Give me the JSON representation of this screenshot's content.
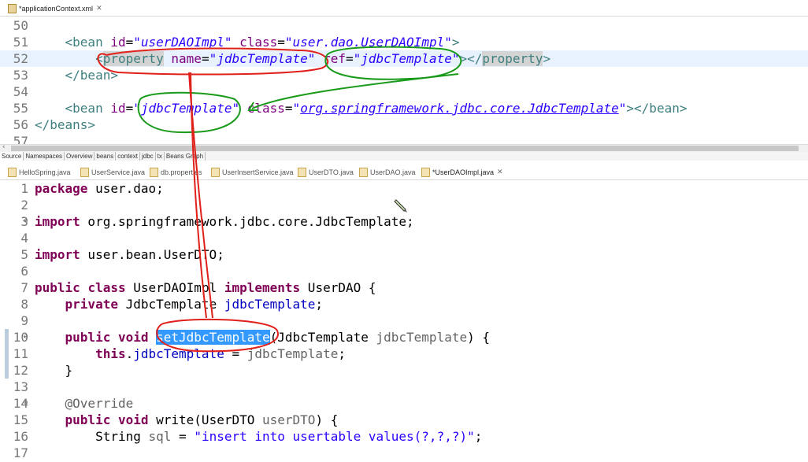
{
  "xml_editor": {
    "tab_label": "*applicationContext.xml",
    "lines": [
      {
        "n": "50",
        "parts": []
      },
      {
        "n": "51",
        "parts": [
          {
            "t": "    ",
            "c": "plain"
          },
          {
            "t": "<bean",
            "c": "tag"
          },
          {
            "t": " id",
            "c": "attr"
          },
          {
            "t": "=",
            "c": "plain"
          },
          {
            "t": "\"userDAOImpl\"",
            "c": "val"
          },
          {
            "t": " class",
            "c": "attr"
          },
          {
            "t": "=",
            "c": "plain"
          },
          {
            "t": "\"user.dao.UserDAOImpl\"",
            "c": "val"
          },
          {
            "t": ">",
            "c": "tag"
          }
        ]
      },
      {
        "n": "52",
        "highlight": true,
        "parts": [
          {
            "t": "        ",
            "c": "plain"
          },
          {
            "t": "<",
            "c": "tag"
          },
          {
            "t": "property",
            "c": "tag occ"
          },
          {
            "t": " name",
            "c": "attr"
          },
          {
            "t": "=",
            "c": "plain"
          },
          {
            "t": "\"jdbcTemplate\"",
            "c": "val"
          },
          {
            "t": " ref",
            "c": "attr"
          },
          {
            "t": "=",
            "c": "plain"
          },
          {
            "t": "\"jdbcTemplate\"",
            "c": "val"
          },
          {
            "t": "></",
            "c": "tag"
          },
          {
            "t": "property",
            "c": "tag occ"
          },
          {
            "t": ">",
            "c": "tag"
          }
        ]
      },
      {
        "n": "53",
        "parts": [
          {
            "t": "    ",
            "c": "plain"
          },
          {
            "t": "</bean>",
            "c": "tag"
          }
        ]
      },
      {
        "n": "54",
        "parts": []
      },
      {
        "n": "55",
        "parts": [
          {
            "t": "    ",
            "c": "plain"
          },
          {
            "t": "<bean",
            "c": "tag"
          },
          {
            "t": " id",
            "c": "attr"
          },
          {
            "t": "=",
            "c": "plain"
          },
          {
            "t": "\"jdbcTemplate\"",
            "c": "val"
          },
          {
            "t": " class",
            "c": "attr"
          },
          {
            "t": "=",
            "c": "plain"
          },
          {
            "t": "\"",
            "c": "val"
          },
          {
            "t": "org.springframework.jdbc.core.JdbcTemplate",
            "c": "val"
          },
          {
            "t": "\"",
            "c": "val"
          },
          {
            "t": "></bean>",
            "c": "tag"
          }
        ]
      },
      {
        "n": "56",
        "parts": [
          {
            "t": "</beans>",
            "c": "tag"
          }
        ]
      },
      {
        "n": "57",
        "parts": []
      }
    ],
    "bottom_tabs": [
      "Source",
      "Namespaces",
      "Overview",
      "beans",
      "context",
      "jdbc",
      "tx",
      "Beans Graph"
    ]
  },
  "file_tabs": [
    {
      "label": "HelloSpring.java"
    },
    {
      "label": "UserService.java"
    },
    {
      "label": "db.properties"
    },
    {
      "label": "UserInsertService.java"
    },
    {
      "label": "UserDTO.java"
    },
    {
      "label": "UserDAO.java"
    },
    {
      "label": "*UserDAOImpl.java",
      "active": true
    }
  ],
  "java_editor": {
    "lines": [
      {
        "n": "1",
        "parts": [
          {
            "t": "package",
            "c": "kw"
          },
          {
            "t": " user.dao;",
            "c": "plain"
          }
        ]
      },
      {
        "n": "2",
        "parts": []
      },
      {
        "n": "3",
        "fold": true,
        "parts": [
          {
            "t": "import",
            "c": "kw"
          },
          {
            "t": " org.springframework.jdbc.core.JdbcTemplate;",
            "c": "plain"
          }
        ]
      },
      {
        "n": "4",
        "parts": []
      },
      {
        "n": "5",
        "parts": [
          {
            "t": "import",
            "c": "kw"
          },
          {
            "t": " user.bean.UserDTO;",
            "c": "plain"
          }
        ]
      },
      {
        "n": "6",
        "parts": []
      },
      {
        "n": "7",
        "parts": [
          {
            "t": "public",
            "c": "kw"
          },
          {
            "t": " ",
            "c": "plain"
          },
          {
            "t": "class",
            "c": "kw"
          },
          {
            "t": " UserDAOImpl ",
            "c": "plain"
          },
          {
            "t": "implements",
            "c": "kw"
          },
          {
            "t": " UserDAO {",
            "c": "plain"
          }
        ]
      },
      {
        "n": "8",
        "parts": [
          {
            "t": "    ",
            "c": "plain"
          },
          {
            "t": "private",
            "c": "kw"
          },
          {
            "t": " JdbcTemplate ",
            "c": "plain"
          },
          {
            "t": "jdbcTemplate",
            "c": "fld"
          },
          {
            "t": ";",
            "c": "plain"
          }
        ]
      },
      {
        "n": "9",
        "parts": []
      },
      {
        "n": "10",
        "fold": true,
        "marker": true,
        "parts": [
          {
            "t": "    ",
            "c": "plain"
          },
          {
            "t": "public",
            "c": "kw"
          },
          {
            "t": " ",
            "c": "plain"
          },
          {
            "t": "void",
            "c": "kw"
          },
          {
            "t": " ",
            "c": "plain"
          },
          {
            "t": "setJdbcTemplate",
            "c": "sel"
          },
          {
            "t": "(JdbcTemplate ",
            "c": "plain"
          },
          {
            "t": "jdbcTemplate",
            "c": "ann"
          },
          {
            "t": ") {",
            "c": "plain"
          }
        ]
      },
      {
        "n": "11",
        "marker": true,
        "parts": [
          {
            "t": "        ",
            "c": "plain"
          },
          {
            "t": "this",
            "c": "kw"
          },
          {
            "t": ".",
            "c": "plain"
          },
          {
            "t": "jdbcTemplate",
            "c": "fld"
          },
          {
            "t": " = ",
            "c": "plain"
          },
          {
            "t": "jdbcTemplate",
            "c": "ann"
          },
          {
            "t": ";",
            "c": "plain"
          }
        ]
      },
      {
        "n": "12",
        "marker": true,
        "parts": [
          {
            "t": "    }",
            "c": "plain"
          }
        ]
      },
      {
        "n": "13",
        "parts": []
      },
      {
        "n": "14",
        "fold": true,
        "parts": [
          {
            "t": "    ",
            "c": "plain"
          },
          {
            "t": "@Override",
            "c": "ann"
          }
        ]
      },
      {
        "n": "15",
        "parts": [
          {
            "t": "    ",
            "c": "plain"
          },
          {
            "t": "public",
            "c": "kw"
          },
          {
            "t": " ",
            "c": "plain"
          },
          {
            "t": "void",
            "c": "kw"
          },
          {
            "t": " write(UserDTO ",
            "c": "plain"
          },
          {
            "t": "userDTO",
            "c": "ann"
          },
          {
            "t": ") {",
            "c": "plain"
          }
        ]
      },
      {
        "n": "16",
        "parts": [
          {
            "t": "        String ",
            "c": "plain"
          },
          {
            "t": "sql",
            "c": "ann"
          },
          {
            "t": " = ",
            "c": "plain"
          },
          {
            "t": "\"insert into usertable values(?,?,?)\"",
            "c": "str"
          },
          {
            "t": ";",
            "c": "plain"
          }
        ]
      },
      {
        "n": "17",
        "parts": []
      }
    ]
  }
}
